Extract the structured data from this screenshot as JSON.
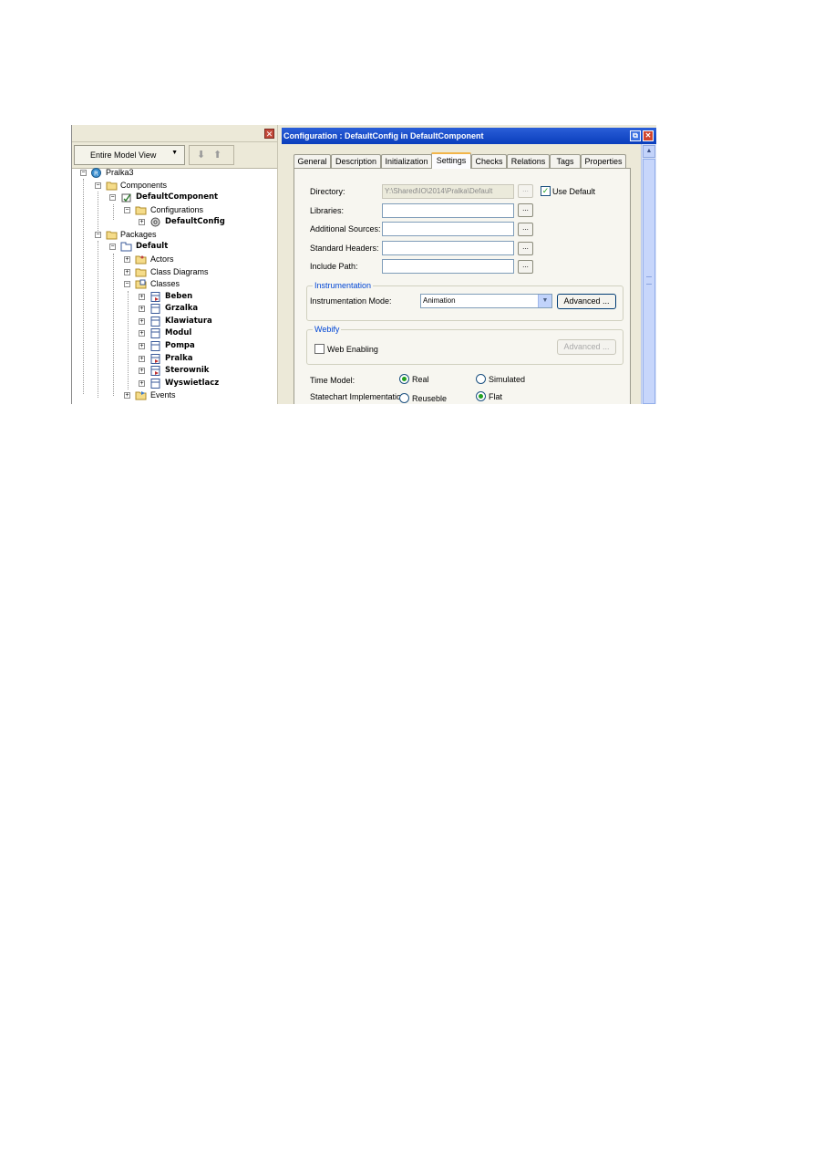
{
  "left_pane": {
    "view_selector": "Entire Model View",
    "tree": [
      {
        "label": "Pralka3",
        "bold": false
      },
      {
        "label": "Components",
        "bold": false
      },
      {
        "label": "DefaultComponent",
        "bold": true
      },
      {
        "label": "Configurations",
        "bold": false
      },
      {
        "label": "DefaultConfig",
        "bold": true
      },
      {
        "label": "Packages",
        "bold": false
      },
      {
        "label": "Default",
        "bold": true
      },
      {
        "label": "Actors",
        "bold": false
      },
      {
        "label": "Class Diagrams",
        "bold": false
      },
      {
        "label": "Classes",
        "bold": false
      },
      {
        "label": "Beben",
        "bold": true
      },
      {
        "label": "Grzalka",
        "bold": true
      },
      {
        "label": "Klawiatura",
        "bold": true
      },
      {
        "label": "Modul",
        "bold": true
      },
      {
        "label": "Pompa",
        "bold": true
      },
      {
        "label": "Pralka",
        "bold": true
      },
      {
        "label": "Sterownik",
        "bold": true
      },
      {
        "label": "Wyswietlacz",
        "bold": true
      },
      {
        "label": "Events",
        "bold": false
      }
    ]
  },
  "right_pane": {
    "title": "Configuration : DefaultConfig in DefaultComponent",
    "tabs": [
      "General",
      "Description",
      "Initialization",
      "Settings",
      "Checks",
      "Relations",
      "Tags",
      "Properties"
    ],
    "active_tab": "Settings",
    "settings": {
      "directory_label": "Directory:",
      "directory_value": "Y:\\Shared\\IO\\2014\\Pralka\\Default",
      "use_default_label": "Use Default",
      "libraries_label": "Libraries:",
      "additional_sources_label": "Additional Sources:",
      "standard_headers_label": "Standard Headers:",
      "include_path_label": "Include Path:",
      "browse_label": "...",
      "instrumentation_group": "Instrumentation",
      "instrumentation_mode_label": "Instrumentation Mode:",
      "instrumentation_mode_value": "Animation",
      "advanced_label": "Advanced ...",
      "webify_group": "Webify",
      "web_enabling_label": "Web Enabling",
      "time_model_label": "Time Model:",
      "time_model_real": "Real",
      "time_model_simulated": "Simulated",
      "statechart_label": "Statechart Implementation:",
      "statechart_reuseable": "Reuseble",
      "statechart_flat": "Flat"
    }
  },
  "colors": {
    "titlebar": "#0a3ebc",
    "window_bg": "#ece9d8",
    "check_green": "#21a121",
    "group_title": "#0046d5"
  }
}
